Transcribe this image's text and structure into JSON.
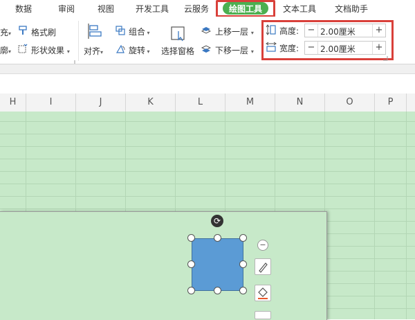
{
  "menu": {
    "items": [
      "数据",
      "审阅",
      "视图",
      "开发工具",
      "云服务",
      "绘图工具",
      "文本工具",
      "文档助手"
    ],
    "active": "绘图工具"
  },
  "ribbon": {
    "fill_partial": "充",
    "format_painter": "格式刷",
    "effect_partial": "廓",
    "shape_effects": "形状效果",
    "align": "对齐",
    "group": "组合",
    "rotate": "旋转",
    "selection_pane": "选择窗格",
    "bring_forward": "上移一层",
    "send_backward": "下移一层"
  },
  "size": {
    "height_label": "高度:",
    "height_value": "2.00厘米",
    "width_label": "宽度:",
    "width_value": "2.00厘米",
    "minus": "−",
    "plus": "+"
  },
  "columns": [
    "H",
    "I",
    "J",
    "K",
    "L",
    "M",
    "N",
    "O",
    "P"
  ],
  "colors": {
    "accent": "#4caf50",
    "highlight": "#d9403a",
    "shape_fill": "#5b9bd5",
    "grid_bg": "#c7e9c9"
  }
}
